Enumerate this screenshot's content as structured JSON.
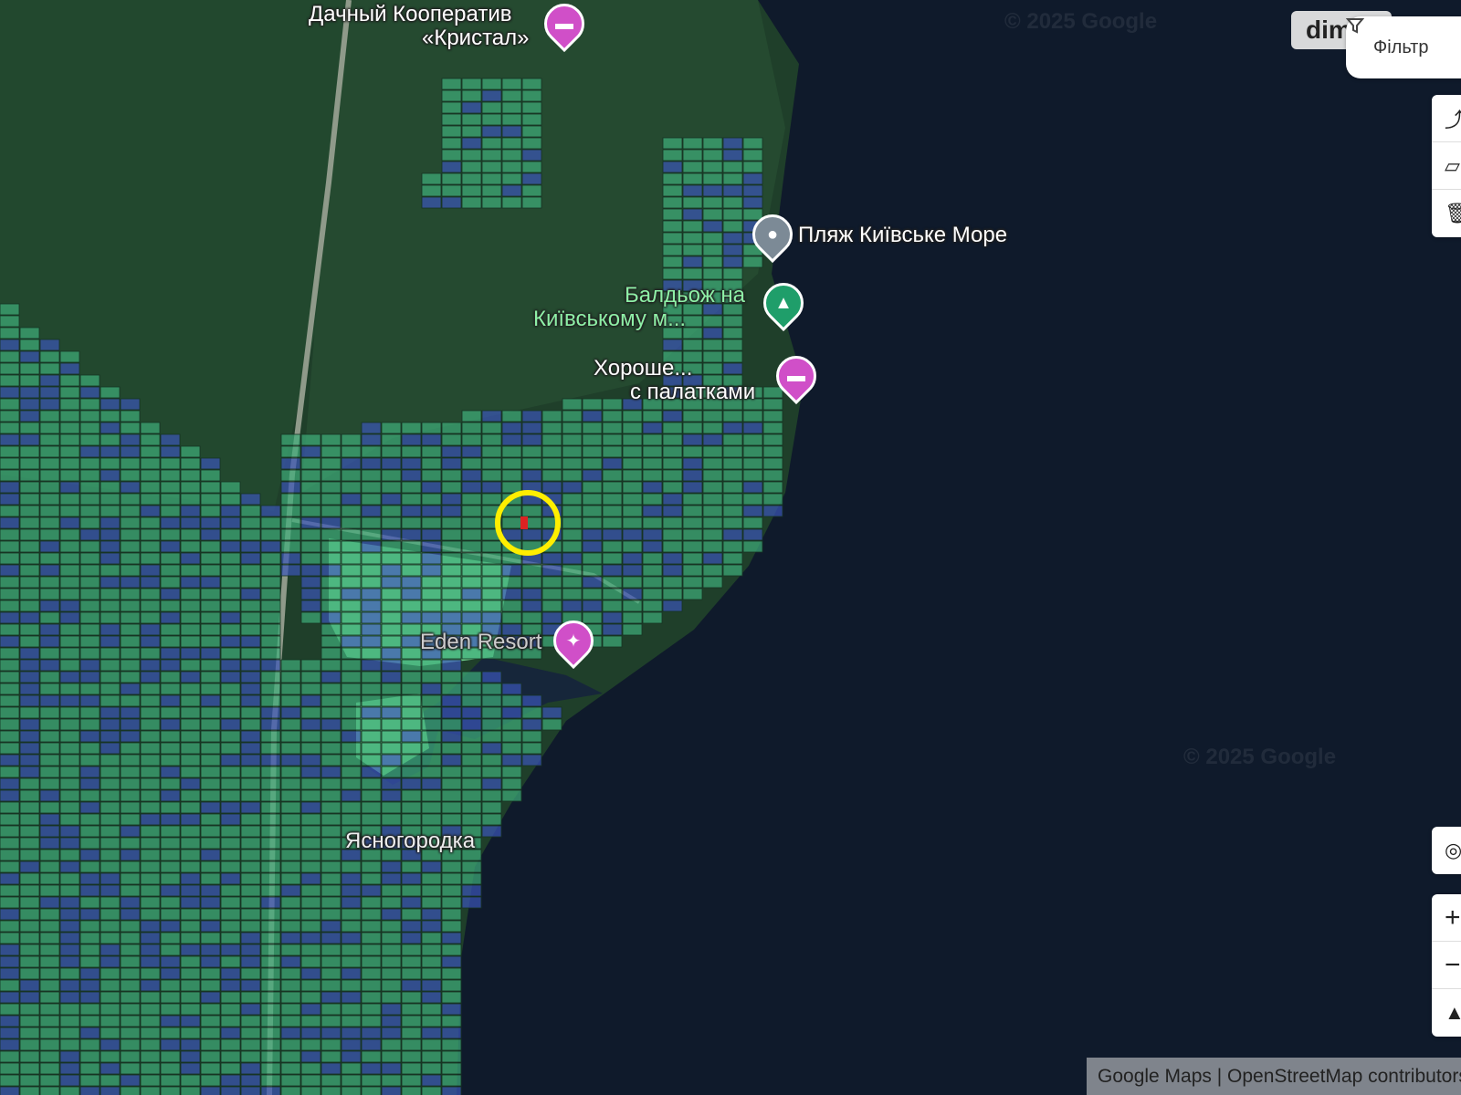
{
  "map": {
    "water_color": "#0f1a2b",
    "forest_color": "#1f3f2a",
    "parcel_green": "#3fae7a",
    "parcel_blue": "#3a55b8",
    "selection_ring_color": "#ffee00"
  },
  "pois": [
    {
      "label": "Дачный Кооператив «Кристал»",
      "line1": "Дачный Кооператив",
      "line2": "«Кристал»",
      "icon": "hotel-icon",
      "color": "#d04fc8"
    },
    {
      "label": "Пляж Київське Море",
      "icon": "place-pin-icon",
      "color": "#7c8a96"
    },
    {
      "label": "Балдьож на Київському морі",
      "line1": "Балдьож на",
      "line2": "Київському м...",
      "icon": "campground-icon",
      "color": "#1f9e6a"
    },
    {
      "label": "Хороше місце з палатками",
      "line1": "Хороше...",
      "line2": "с палатками",
      "icon": "hotel-icon",
      "color": "#d04fc8"
    },
    {
      "label": "Eden Resort",
      "icon": "resort-icon",
      "color": "#d04fc8"
    }
  ],
  "place_labels": {
    "village": "Ясногородка"
  },
  "watermarks": [
    "© 2025 Google",
    "© 2025 Google"
  ],
  "controls": {
    "dim_chip": "dim",
    "filter_label": "Фільтр",
    "filter_icon": "filter-icon",
    "tools": [
      "route-icon",
      "polygon-icon",
      "trash-icon"
    ],
    "locate_icon": "locate-icon",
    "zoom_in": "+",
    "zoom_out": "−",
    "compass_icon": "compass-icon"
  },
  "attribution": "Google Maps | OpenStreetMap contributors"
}
